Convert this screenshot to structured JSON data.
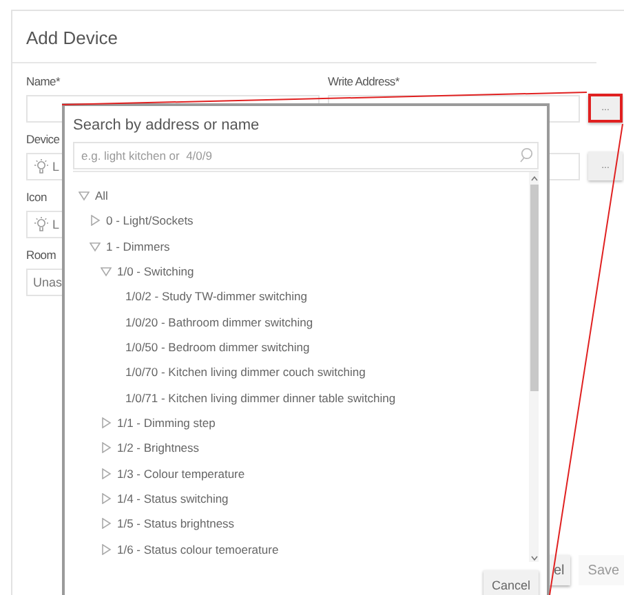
{
  "dialog": {
    "title": "Add Device",
    "rows": [
      {
        "left": {
          "label": "Name*"
        },
        "right": {
          "label": "Write Address*",
          "button": "...",
          "highlighted": true
        }
      },
      {
        "left": {
          "label": "Device",
          "value": "L",
          "icon": true
        },
        "right": {
          "button": "...",
          "highlighted": false
        }
      },
      {
        "left": {
          "label": "Icon",
          "value": "L",
          "icon": true
        }
      },
      {
        "left": {
          "label": "Room",
          "value": "Unas"
        }
      }
    ],
    "buttons": [
      {
        "label": "el",
        "disabled": false
      },
      {
        "label": "Save",
        "disabled": true
      }
    ]
  },
  "picker": {
    "title": "Search by address or name",
    "search": {
      "placeholder": "e.g. light kitchen or  4/0/9"
    },
    "tree": [
      {
        "label": "All",
        "expanded": true,
        "children": [
          {
            "label": "0 - Light/Sockets",
            "expanded": false
          },
          {
            "label": "1 - Dimmers",
            "expanded": true,
            "children": [
              {
                "label": "1/0 - Switching",
                "expanded": true,
                "children": [
                  {
                    "label": "1/0/2 - Study TW-dimmer switching"
                  },
                  {
                    "label": "1/0/20 - Bathroom dimmer switching"
                  },
                  {
                    "label": "1/0/50 - Bedroom dimmer switching"
                  },
                  {
                    "label": "1/0/70 - Kitchen living dimmer couch switching"
                  },
                  {
                    "label": "1/0/71 - Kitchen living dimmer dinner table switching"
                  }
                ]
              },
              {
                "label": "1/1 - Dimming step",
                "expanded": false
              },
              {
                "label": "1/2 - Brightness",
                "expanded": false
              },
              {
                "label": "1/3 - Colour temperature",
                "expanded": false
              },
              {
                "label": "1/4 - Status switching",
                "expanded": false
              },
              {
                "label": "1/5 - Status brightness",
                "expanded": false
              },
              {
                "label": "1/6 - Status colour temoerature",
                "expanded": false
              }
            ]
          }
        ]
      }
    ],
    "buttons": [
      {
        "label": "Cancel"
      }
    ]
  }
}
